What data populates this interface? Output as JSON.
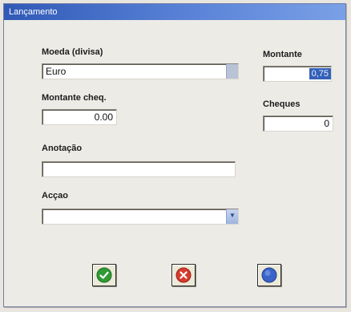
{
  "window": {
    "title": "Lançamento"
  },
  "form": {
    "moeda_label": "Moeda (divisa)",
    "moeda_value": "Euro",
    "montante_label": "Montante",
    "montante_value": "0,75",
    "montante_cheq_label": "Montante cheq.",
    "montante_cheq_value": "0.00",
    "cheques_label": "Cheques",
    "cheques_value": "0",
    "anotacao_label": "Anotação",
    "anotacao_value": "",
    "accao_label": "Acçao",
    "accao_value": ""
  },
  "buttons": {
    "ok_icon": "check-icon",
    "cancel_icon": "close-icon",
    "help_icon": "help-icon"
  },
  "colors": {
    "ok": "#2e9b35",
    "cancel": "#d83a2e",
    "help": "#3a63c9"
  }
}
